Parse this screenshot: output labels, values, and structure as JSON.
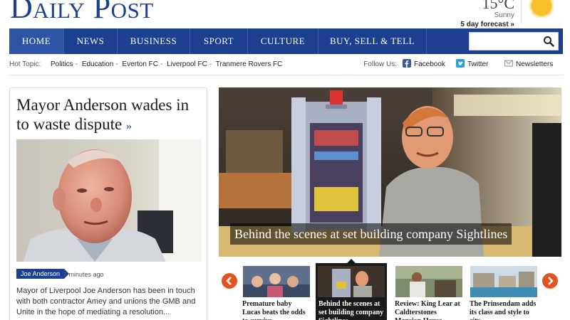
{
  "masthead": {
    "logo": "Daily Post",
    "weather": {
      "temp": "15°C",
      "condition": "Sunny",
      "forecast": "5 day forecast »"
    }
  },
  "nav": {
    "items": [
      "HOME",
      "NEWS",
      "BUSINESS",
      "SPORT",
      "CULTURE",
      "BUY, SELL & TELL"
    ],
    "active": "HOME",
    "search_placeholder": ""
  },
  "hot_topics": {
    "label": "Hot Topic:",
    "links": [
      "Politics",
      "Education",
      "Everton FC",
      "Liverpool FC",
      "Tranmere Rovers FC"
    ]
  },
  "follow": {
    "label": "Follow Us:",
    "items": [
      {
        "label": "Facebook",
        "icon": "facebook-icon"
      },
      {
        "label": "Twitter",
        "icon": "twitter-icon"
      },
      {
        "label": "Newsletters",
        "icon": "envelope-icon"
      }
    ]
  },
  "lead_story": {
    "headline": "Mayor Anderson wades in to waste dispute",
    "arrow": "»",
    "tag": "Joe Anderson",
    "time": "7 minutes ago",
    "summary": "Mayor of Liverpool Joe Anderson has been in touch with both contractor Amey and unions the GMB and Unite in the hope of mediating a resolution..."
  },
  "hero": {
    "caption": "Behind the scenes at set building company Sightlines"
  },
  "carousel": {
    "items": [
      {
        "title": "Premature baby Lucas beats the odds to survive"
      },
      {
        "title": "Behind the scenes at set building company Sightlines"
      },
      {
        "title": "Review: King Lear at Caldterstones Mansion House"
      },
      {
        "title": "The Prinsendam adds its class and style to city"
      }
    ],
    "active_index": 1
  },
  "colors": {
    "brand": "#1d3f8f",
    "accent": "#e0541f"
  }
}
